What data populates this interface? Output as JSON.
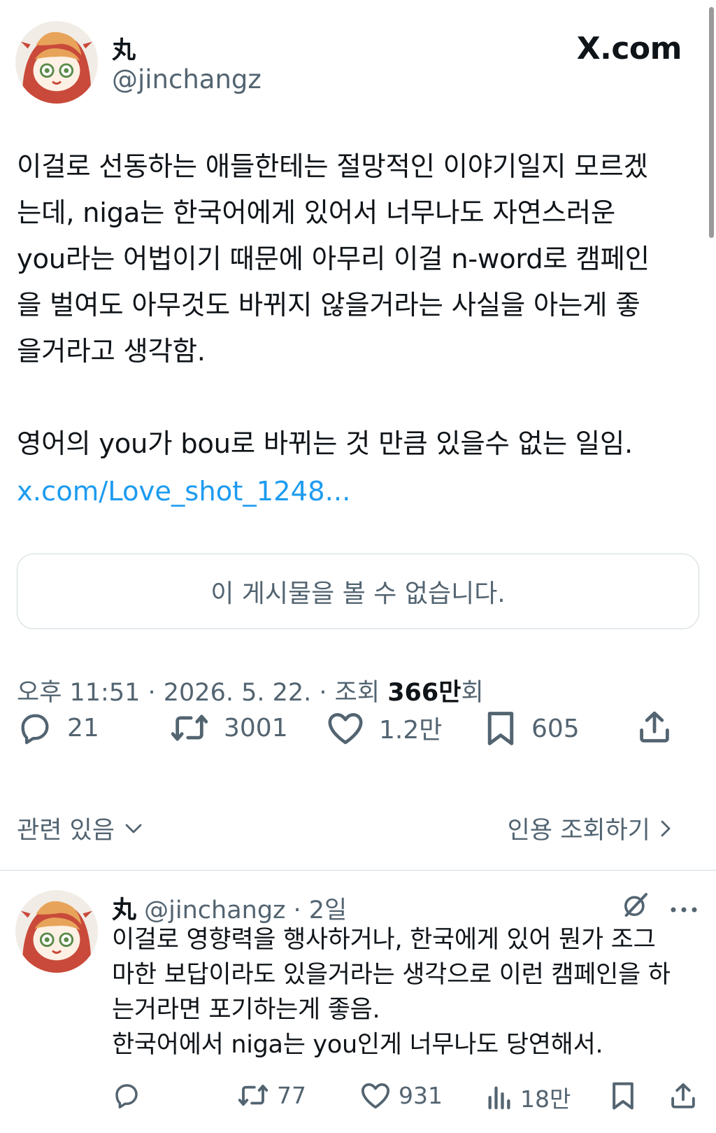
{
  "post": {
    "display_name": "丸",
    "handle": "@jinchangz",
    "brand": "X.com",
    "body": "이걸로 선동하는 애들한테는 절망적인 이야기일지 모르겠\n는데, niga는 한국어에게 있어서 너무나도 자연스러운\nyou라는 어법이기 때문에 아무리 이걸 n-word로 캠페인\n을 벌여도 아무것도 바뀌지 않을거라는 사실을 아는게 좋\n을거라고 생각함.\n\n영어의 you가 bou로 바뀌는 것 만큼 있을수 없는 일임.",
    "link": "x.com/Love_shot_1248...",
    "quote_unavailable": "이 게시물을 볼 수 없습니다.",
    "meta_prefix": "오후 11:51 · 2026. 5. 22. · 조회 ",
    "views_number": "366만",
    "views_suffix": "회",
    "actions": {
      "reply_count": "21",
      "repost_count": "3001",
      "like_count": "1.2만",
      "bookmark_count": "605"
    },
    "related_label": "관련 있음",
    "quote_views_label": "인용 조회하기"
  },
  "reply": {
    "display_name": "丸",
    "handle_time": " @jinchangz · 2일",
    "body": "이걸로 영향력을 행사하거나, 한국에게 있어 뭔가 조그\n마한 보답이라도 있을거라는 생각으로 이런 캠페인을 하\n는거라면 포기하는게 좋음.\n한국어에서 niga는 you인게 너무나도 당연해서.",
    "actions": {
      "repost_count": "77",
      "like_count": "931",
      "views_count": "18만"
    }
  },
  "icons": {
    "reply": "reply-icon",
    "repost": "repost-icon",
    "like": "heart-icon",
    "bookmark": "bookmark-icon",
    "share": "share-icon",
    "views": "analytics-icon",
    "grok": "grok-icon",
    "more": "more-icon"
  },
  "colors": {
    "link": "#1d9bf0",
    "secondary_text": "#536471",
    "primary_text": "#0f1419",
    "border": "#cfd9de"
  }
}
